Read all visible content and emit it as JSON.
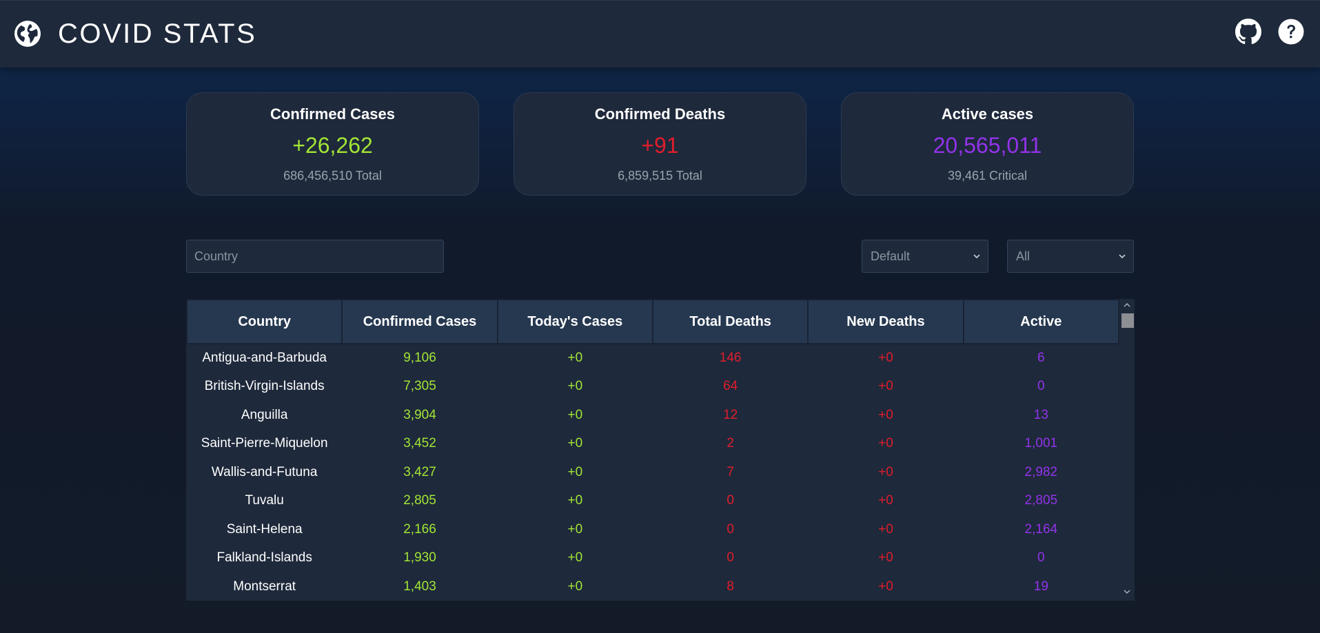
{
  "header": {
    "title": "COVID STATS",
    "logo_icon": "globe-icon",
    "github_icon": "github-icon",
    "help_icon": "help-circle-icon"
  },
  "stats": [
    {
      "title": "Confirmed Cases",
      "value": "+26,262",
      "sub": "686,456,510 Total",
      "color": "#a3e635"
    },
    {
      "title": "Confirmed Deaths",
      "value": "+91",
      "sub": "6,859,515 Total",
      "color": "#e11d2b"
    },
    {
      "title": "Active cases",
      "value": "20,565,011",
      "sub": "39,461 Critical",
      "color": "#9333ea"
    }
  ],
  "search": {
    "placeholder": "Country",
    "value": ""
  },
  "sort_select": {
    "value": "Default"
  },
  "filter_select": {
    "value": "All"
  },
  "table": {
    "columns": [
      "Country",
      "Confirmed Cases",
      "Today's Cases",
      "Total Deaths",
      "New Deaths",
      "Active"
    ],
    "rows": [
      {
        "country": "Antigua-and-Barbuda",
        "confirmed": "9,106",
        "today": "+0",
        "deaths": "146",
        "new_deaths": "+0",
        "active": "6"
      },
      {
        "country": "British-Virgin-Islands",
        "confirmed": "7,305",
        "today": "+0",
        "deaths": "64",
        "new_deaths": "+0",
        "active": "0"
      },
      {
        "country": "Anguilla",
        "confirmed": "3,904",
        "today": "+0",
        "deaths": "12",
        "new_deaths": "+0",
        "active": "13"
      },
      {
        "country": "Saint-Pierre-Miquelon",
        "confirmed": "3,452",
        "today": "+0",
        "deaths": "2",
        "new_deaths": "+0",
        "active": "1,001"
      },
      {
        "country": "Wallis-and-Futuna",
        "confirmed": "3,427",
        "today": "+0",
        "deaths": "7",
        "new_deaths": "+0",
        "active": "2,982"
      },
      {
        "country": "Tuvalu",
        "confirmed": "2,805",
        "today": "+0",
        "deaths": "0",
        "new_deaths": "+0",
        "active": "2,805"
      },
      {
        "country": "Saint-Helena",
        "confirmed": "2,166",
        "today": "+0",
        "deaths": "0",
        "new_deaths": "+0",
        "active": "2,164"
      },
      {
        "country": "Falkland-Islands",
        "confirmed": "1,930",
        "today": "+0",
        "deaths": "0",
        "new_deaths": "+0",
        "active": "0"
      },
      {
        "country": "Montserrat",
        "confirmed": "1,403",
        "today": "+0",
        "deaths": "8",
        "new_deaths": "+0",
        "active": "19"
      }
    ]
  },
  "colors": {
    "positive": "#a3e635",
    "deaths": "#e11d2b",
    "active": "#9333ea",
    "panel": "#1e293b",
    "table_header": "#263850"
  }
}
